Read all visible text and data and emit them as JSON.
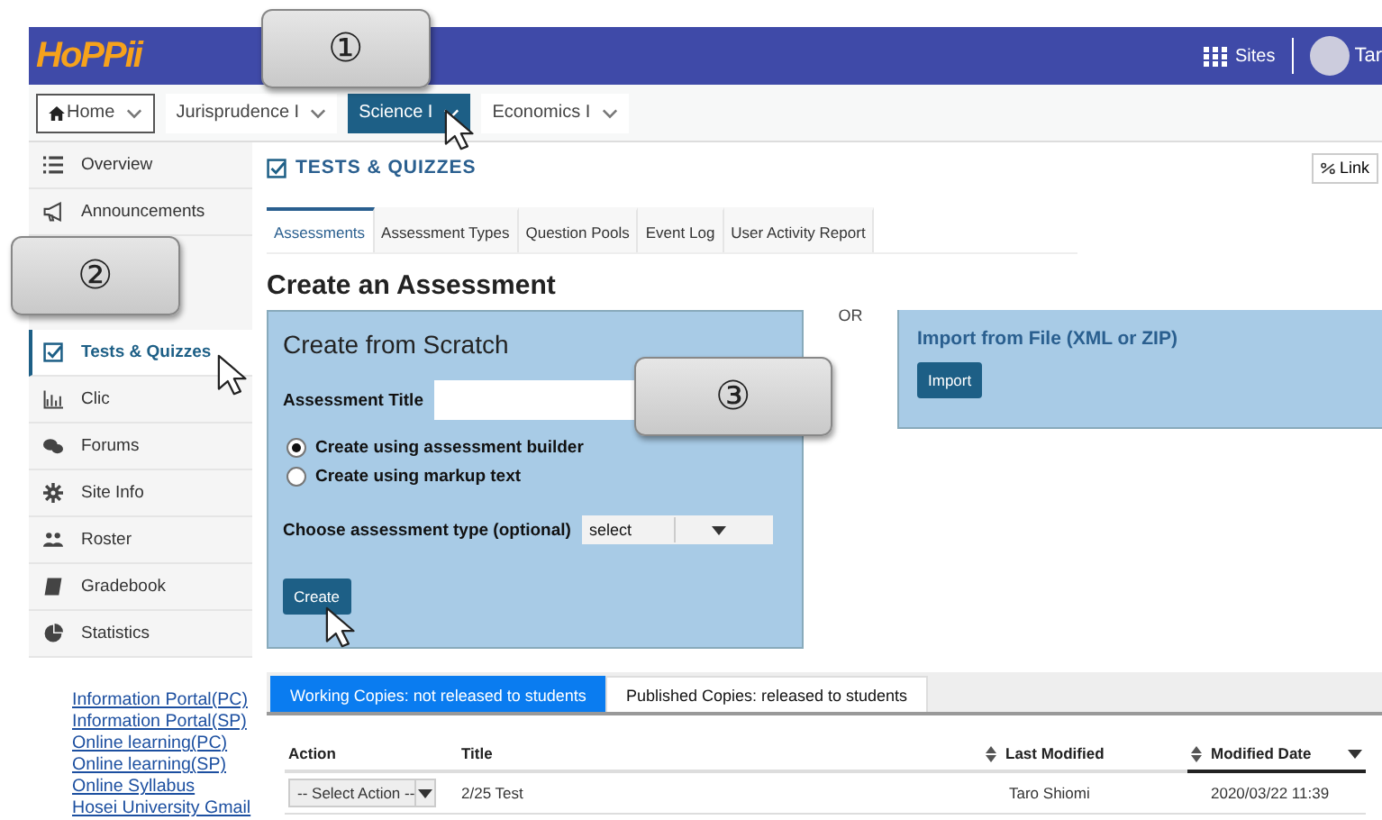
{
  "header": {
    "logo": "HoPPii",
    "sites": "Sites",
    "user": "Tar"
  },
  "site_tabs": [
    {
      "label": "Home",
      "kind": "home",
      "selected": false
    },
    {
      "label": "Jurisprudence I",
      "kind": "site",
      "selected": false
    },
    {
      "label": "Science I",
      "kind": "site",
      "selected": true
    },
    {
      "label": "Economics I",
      "kind": "site",
      "selected": false
    }
  ],
  "sidebar": {
    "items": [
      {
        "kind": "tool",
        "label": "Overview",
        "selected": false
      },
      {
        "kind": "tool",
        "label": "Announcements",
        "selected": false
      },
      {
        "kind": "callout",
        "label": "②"
      },
      {
        "kind": "tool",
        "label": "Tests & Quizzes",
        "selected": true
      },
      {
        "kind": "tool",
        "label": "Clic",
        "selected": false
      },
      {
        "kind": "tool",
        "label": "Forums",
        "selected": false
      },
      {
        "kind": "tool",
        "label": "Site Info",
        "selected": false
      },
      {
        "kind": "tool",
        "label": "Roster",
        "selected": false
      },
      {
        "kind": "tool",
        "label": "Gradebook",
        "selected": false
      },
      {
        "kind": "tool",
        "label": "Statistics",
        "selected": false
      }
    ],
    "links": [
      "Information Portal(PC)",
      "Information Portal(SP)",
      "Online learning(PC)",
      "Online learning(SP)",
      "Online Syllabus",
      "Hosei University Gmail"
    ]
  },
  "tool_title": "TESTS & QUIZZES",
  "link_button": "Link",
  "callouts": [
    {
      "label": "①"
    },
    {
      "label": "③"
    }
  ],
  "tabs": [
    {
      "label": "Assessments",
      "selected": true
    },
    {
      "label": "Assessment Types",
      "selected": false
    },
    {
      "label": "Question Pools",
      "selected": false
    },
    {
      "label": "Event Log",
      "selected": false
    },
    {
      "label": "User Activity Report",
      "selected": false
    }
  ],
  "heading": "Create an Assessment",
  "scratch": {
    "title": "Create from Scratch",
    "field_label": "Assessment Title",
    "options": [
      {
        "label": "Create using assessment builder",
        "selected": true
      },
      {
        "label": "Create using markup text",
        "selected": false
      }
    ],
    "type_label": "Choose assessment type (optional)",
    "type_value": "select",
    "button": "Create"
  },
  "or": "OR",
  "import": {
    "title": "Import from File (XML or ZIP)",
    "button": "Import"
  },
  "copy_tabs": [
    {
      "label": "Working Copies: not released to students",
      "selected": true
    },
    {
      "label": "Published Copies: released to students",
      "selected": false
    }
  ],
  "table": {
    "columns": [
      "Action",
      "Title",
      "Last Modified",
      "Modified Date"
    ],
    "rows": [
      {
        "action": "-- Select Action --",
        "title": "2/25 Test",
        "last_modified": "Taro Shiomi",
        "modified_date": "2020/03/22 11:39"
      }
    ]
  }
}
